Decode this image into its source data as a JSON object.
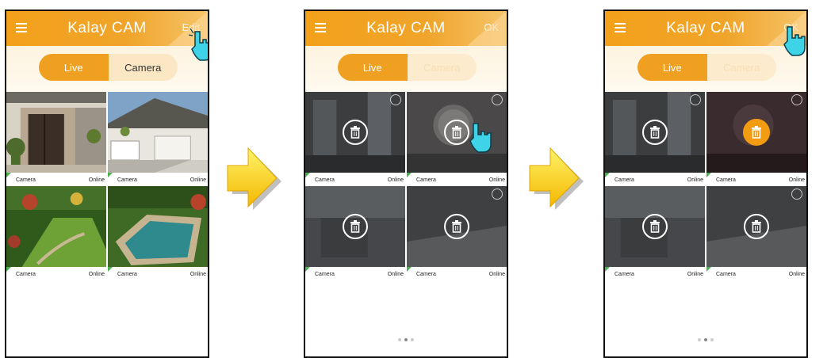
{
  "app": {
    "title": "Kalay CAM",
    "edit_label": "Edit",
    "ok_label": "OK"
  },
  "toggle": {
    "live": "Live",
    "camera": "Camera"
  },
  "cameras": [
    {
      "name": "Camera",
      "status": "Online"
    },
    {
      "name": "Camera",
      "status": "Online"
    },
    {
      "name": "Camera",
      "status": "Online"
    },
    {
      "name": "Camera",
      "status": "Online"
    }
  ],
  "colors": {
    "accent": "#f0a020",
    "online_flag": "#4caf50",
    "arrow": "#f7c800"
  },
  "icons": {
    "menu": "menu-icon",
    "trash": "trash-icon",
    "hand": "pointing-hand-icon",
    "arrow": "right-arrow-icon",
    "more": "more-dots-icon"
  },
  "pager": {
    "pages": 3,
    "current": 2
  }
}
